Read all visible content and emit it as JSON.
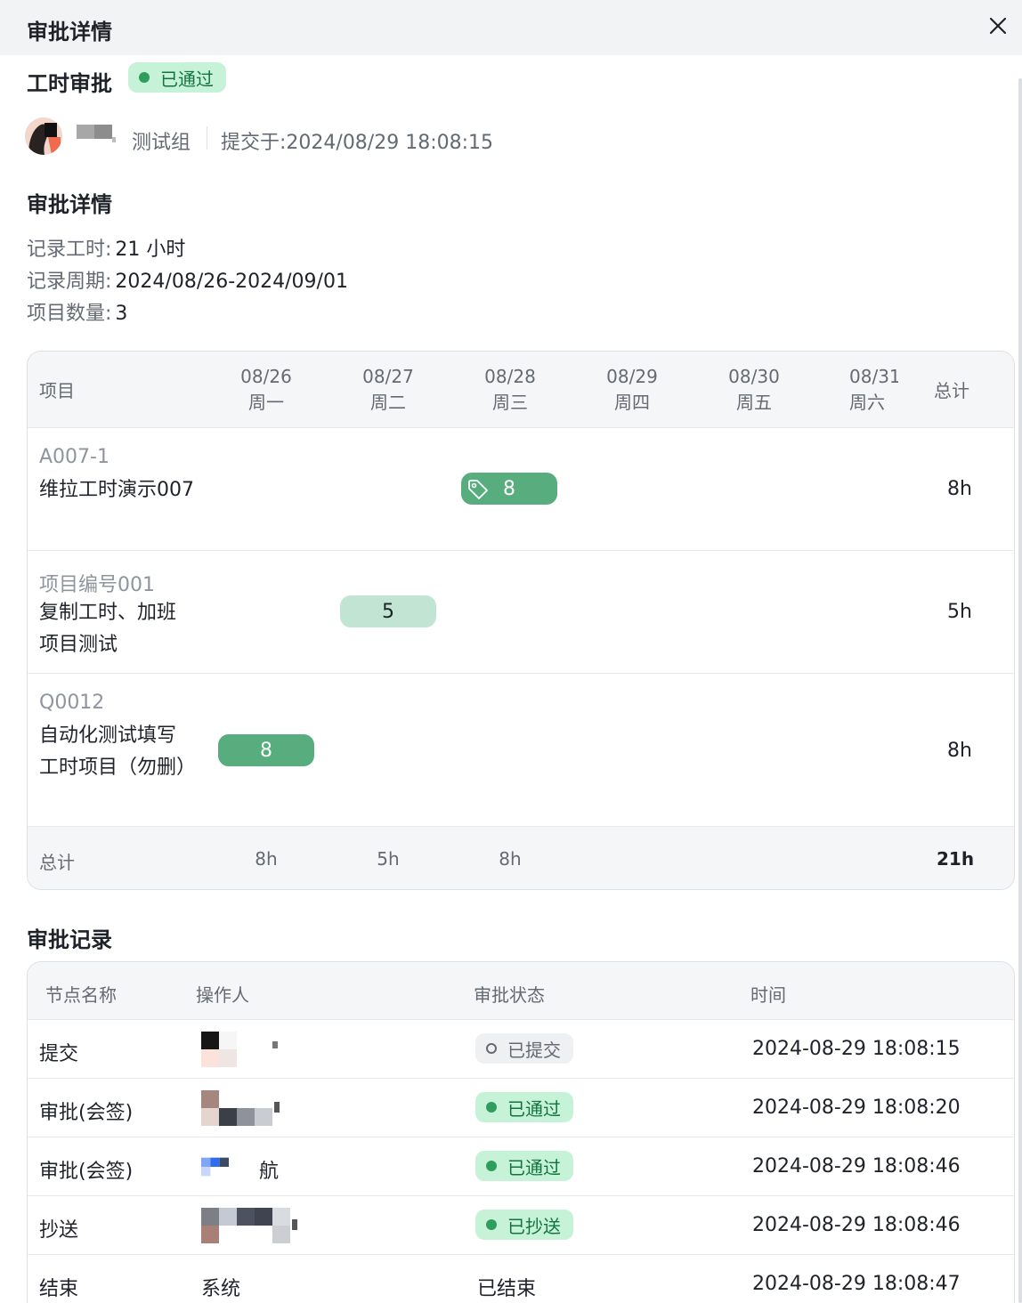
{
  "header": {
    "title": "审批详情"
  },
  "approval": {
    "type_title": "工时审批",
    "status": "已通过",
    "submitter_group": "测试组",
    "submitted_at": "提交于:2024/08/29 18:08:15"
  },
  "details": {
    "section_title": "审批详情",
    "recorded_hours": {
      "label": "记录工时:",
      "value": "21 小时"
    },
    "record_period": {
      "label": "记录周期:",
      "value": "2024/08/26-2024/09/01"
    },
    "project_count": {
      "label": "项目数量:",
      "value": "3"
    }
  },
  "timesheet": {
    "col_project": "项目",
    "col_total": "总计",
    "days": [
      {
        "date": "08/26",
        "weekday": "周一"
      },
      {
        "date": "08/27",
        "weekday": "周二"
      },
      {
        "date": "08/28",
        "weekday": "周三"
      },
      {
        "date": "08/29",
        "weekday": "周四"
      },
      {
        "date": "08/30",
        "weekday": "周五"
      },
      {
        "date": "08/31",
        "weekday": "周六"
      }
    ],
    "rows": [
      {
        "code": "A007-1",
        "name": "维拉工时演示007",
        "hours": "8",
        "day": "08/28",
        "total": "8h",
        "style": "dark-tagged"
      },
      {
        "code": "项目编号001",
        "name": "复制工时、加班项目测试",
        "hours": "5",
        "day": "08/27",
        "total": "5h",
        "style": "light"
      },
      {
        "code": "Q0012",
        "name": "自动化测试填写工时项目（勿删）",
        "hours": "8",
        "day": "08/26",
        "total": "8h",
        "style": "dark"
      }
    ],
    "footer": {
      "label": "总计",
      "day_totals": [
        "8h",
        "5h",
        "8h"
      ],
      "grand_total": "21h"
    }
  },
  "records": {
    "section_title": "审批记录",
    "headers": {
      "node": "节点名称",
      "operator": "操作人",
      "status": "审批状态",
      "time": "时间"
    },
    "rows": [
      {
        "node": "提交",
        "operator_fragment": "",
        "status": "已提交",
        "status_style": "submitted",
        "time": "2024-08-29 18:08:15"
      },
      {
        "node": "审批(会签)",
        "operator_fragment": "",
        "status": "已通过",
        "status_style": "approved",
        "time": "2024-08-29 18:08:20"
      },
      {
        "node": "审批(会签)",
        "operator_fragment": "航",
        "status": "已通过",
        "status_style": "approved",
        "time": "2024-08-29 18:08:46"
      },
      {
        "node": "抄送",
        "operator_fragment": "",
        "status": "已抄送",
        "status_style": "approved",
        "time": "2024-08-29 18:08:46"
      },
      {
        "node": "结束",
        "operator": "系统",
        "status": "已结束",
        "status_style": "plain",
        "time": "2024-08-29 18:08:47"
      }
    ]
  },
  "colors": {
    "approved_bg": "#c6f2d8",
    "approved_text": "#13733f",
    "hours_dark": "#57ad7d",
    "hours_light": "#c1e4d3"
  },
  "icons": {
    "close": "close-icon",
    "tag": "tag-icon",
    "status_dot": "status-dot-icon"
  }
}
